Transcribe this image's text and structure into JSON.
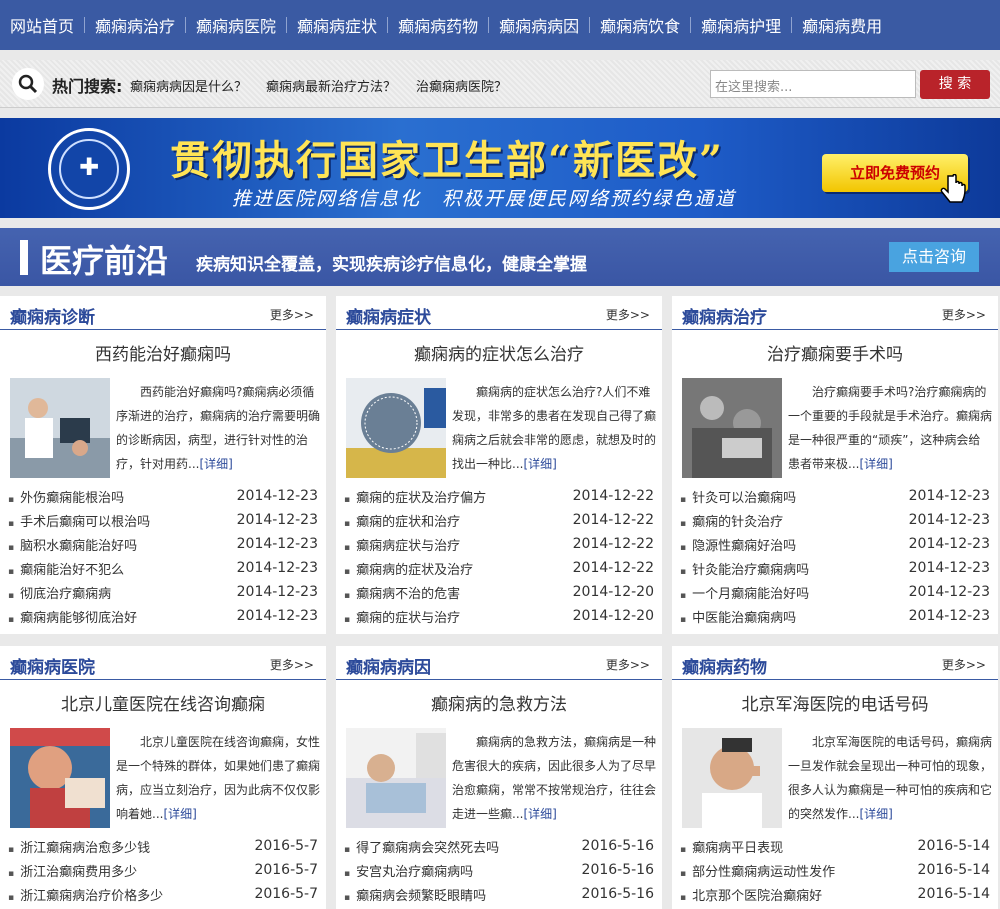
{
  "nav": [
    "网站首页",
    "癫痫病治疗",
    "癫痫病医院",
    "癫痫病症状",
    "癫痫病药物",
    "癫痫病病因",
    "癫痫病饮食",
    "癫痫病护理",
    "癫痫病费用"
  ],
  "hot": {
    "title": "热门搜索:",
    "keywords": [
      "癫痫病病因是什么？",
      "癫痫病最新治疗方法？",
      "治癫痫病医院？"
    ],
    "placeholder": "在这里搜索...",
    "button": "搜 索"
  },
  "banner": {
    "headline": "贯彻执行国家卫生部“新医改”",
    "subline": "推进医院网络信息化　积极开展便民网络预约绿色通道",
    "book": "立即免费预约"
  },
  "section": {
    "title": "医疗前沿",
    "subtitle": "疾病知识全覆盖，实现疾病诊疗信息化，健康全掌握",
    "consult": "点击咨询"
  },
  "more_label": "更多>>",
  "detail_label": "[详细]",
  "cards": [
    {
      "category": "癫痫病诊断",
      "title": "西药能治好癫痫吗",
      "summary": "西药能治好癫痫吗?癫痫病必须循序渐进的治疗，癫痫病的治疗需要明确的诊断病因，病型，进行针对性的治疗，针对用药...",
      "items": [
        {
          "text": "外伤癫痫能根治吗",
          "date": "2014-12-23"
        },
        {
          "text": "手术后癫痫可以根治吗",
          "date": "2014-12-23"
        },
        {
          "text": "脑积水癫痫能治好吗",
          "date": "2014-12-23"
        },
        {
          "text": "癫痫能治好不犯么",
          "date": "2014-12-23"
        },
        {
          "text": "彻底治疗癫痫病",
          "date": "2014-12-23"
        },
        {
          "text": "癫痫病能够彻底治好",
          "date": "2014-12-23"
        }
      ]
    },
    {
      "category": "癫痫病症状",
      "title": "癫痫病的症状怎么治疗",
      "summary": "癫痫病的症状怎么治疗?人们不难发现，非常多的患者在发现自己得了癫痫病之后就会非常的愿虑，就想及时的找出一种比...",
      "items": [
        {
          "text": "癫痫的症状及治疗偏方",
          "date": "2014-12-22"
        },
        {
          "text": "癫痫的症状和治疗",
          "date": "2014-12-22"
        },
        {
          "text": "癫痫病症状与治疗",
          "date": "2014-12-22"
        },
        {
          "text": "癫痫病的症状及治疗",
          "date": "2014-12-22"
        },
        {
          "text": "癫痫病不治的危害",
          "date": "2014-12-20"
        },
        {
          "text": "癫痫的症状与治疗",
          "date": "2014-12-20"
        }
      ]
    },
    {
      "category": "癫痫病治疗",
      "title": "治疗癫痫要手术吗",
      "summary": "治疗癫痫要手术吗?治疗癫痫病的一个重要的手段就是手术治疗。癫痫病是一种很严重的“顽疾”，这种病会给患者带来极...",
      "items": [
        {
          "text": "针灸可以治癫痫吗",
          "date": "2014-12-23"
        },
        {
          "text": "癫痫的针灸治疗",
          "date": "2014-12-23"
        },
        {
          "text": "隐源性癫痫好治吗",
          "date": "2014-12-23"
        },
        {
          "text": "针灸能治疗癫痫病吗",
          "date": "2014-12-23"
        },
        {
          "text": "一个月癫痫能治好吗",
          "date": "2014-12-23"
        },
        {
          "text": "中医能治癫痫病吗",
          "date": "2014-12-23"
        }
      ]
    },
    {
      "category": "癫痫病医院",
      "title": "北京儿童医院在线咨询癫痫",
      "summary": "北京儿童医院在线咨询癫痫，女性是一个特殊的群体，如果她们患了癫痫病，应当立刻治疗，因为此病不仅仅影响着她...",
      "items": [
        {
          "text": "浙江癫痫病治愈多少钱",
          "date": "2016-5-7"
        },
        {
          "text": "浙江治癫痫费用多少",
          "date": "2016-5-7"
        },
        {
          "text": "浙江癫痫病治疗价格多少",
          "date": "2016-5-7"
        }
      ]
    },
    {
      "category": "癫痫病病因",
      "title": "癫痫病的急救方法",
      "summary": "癫痫病的急救方法，癫痫病是一种危害很大的疾病，因此很多人为了尽早治愈癫痫，常常不按常规治疗，往往会走进一些癫...",
      "items": [
        {
          "text": "得了癫痫病会突然死去吗",
          "date": "2016-5-16"
        },
        {
          "text": "安宫丸治疗癫痫病吗",
          "date": "2016-5-16"
        },
        {
          "text": "癫痫病会频繁眨眼睛吗",
          "date": "2016-5-16"
        }
      ]
    },
    {
      "category": "癫痫病药物",
      "title": "北京军海医院的电话号码",
      "summary": "北京军海医院的电话号码，癫痫病一旦发作就会呈现出一种可怕的现象，很多人认为癫痫是一种可怕的疾病和它的突然发作...",
      "items": [
        {
          "text": "癫痫病平日表现",
          "date": "2016-5-14"
        },
        {
          "text": "部分性癫痫病运动性发作",
          "date": "2016-5-14"
        },
        {
          "text": "北京那个医院治癫痫好",
          "date": "2016-5-14"
        }
      ]
    }
  ]
}
